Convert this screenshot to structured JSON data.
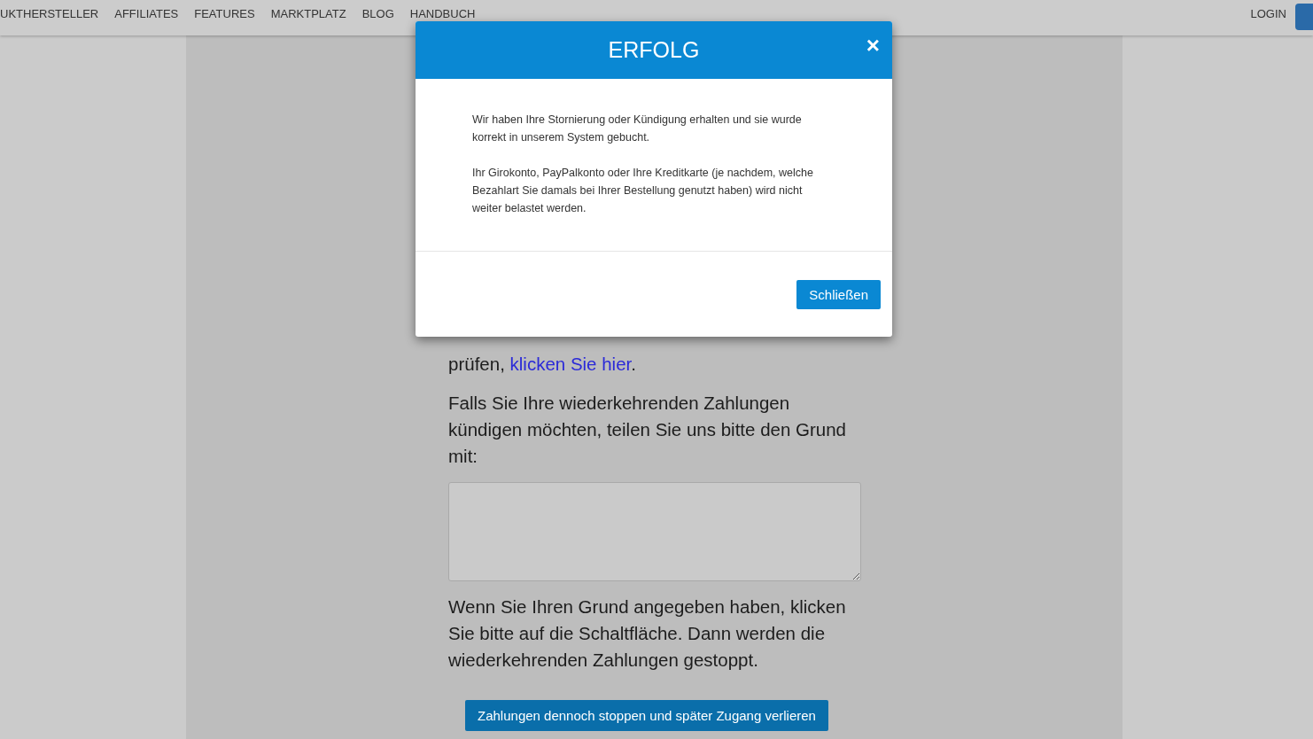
{
  "nav": {
    "items": [
      "UKTHERSTELLER",
      "AFFILIATES",
      "FEATURES",
      "MARKTPLATZ",
      "BLOG",
      "HANDBUCH"
    ],
    "login": "LOGIN"
  },
  "content": {
    "paragraphs": [
      {
        "text": "prüfen, ",
        "link": "klicken Sie hier",
        "after": "."
      },
      {
        "text": "Falls Sie Ihre wiederkehrenden Zahlungen kündigen möchten, teilen Sie uns bitte den Grund mit:"
      }
    ],
    "note": "Wenn Sie Ihren Grund angegeben haben, klicken Sie bitte auf die Schaltfläche. Dann werden die wiederkehrenden Zahlungen gestoppt.",
    "submit": "Zahlungen dennoch stoppen und später Zugang verlieren"
  },
  "modal": {
    "title": "ERFOLG",
    "close": "×",
    "paragraphs": [
      "Wir haben Ihre Stornierung oder Kündigung erhalten und sie wurde korrekt in unserem System gebucht.",
      "Ihr Girokonto, PayPalkonto oder Ihre Kreditkarte (je nachdem, welche Bezahlart Sie damals bei Ihrer Bestellung genutzt haben) wird nicht weiter belastet werden."
    ],
    "button": "Schließen"
  }
}
